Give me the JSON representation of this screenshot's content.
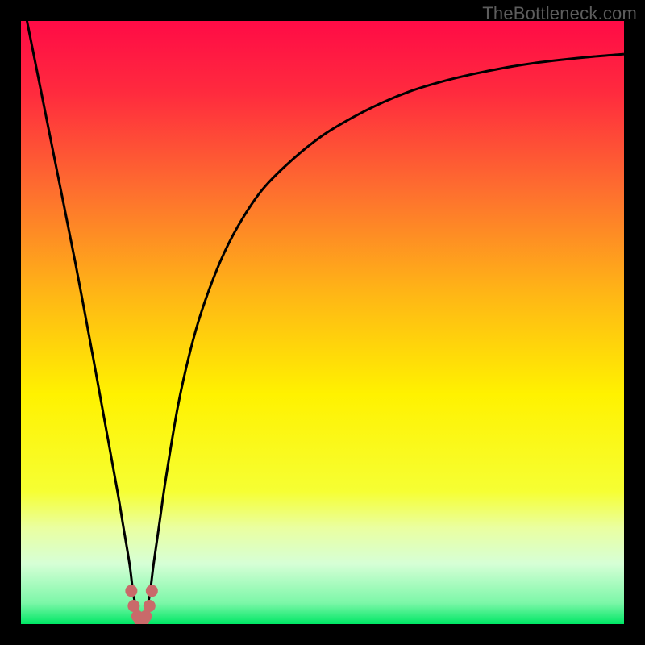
{
  "watermark": "TheBottleneck.com",
  "chart_data": {
    "type": "line",
    "title": "",
    "xlabel": "",
    "ylabel": "",
    "xlim": [
      0,
      100
    ],
    "ylim": [
      0,
      100
    ],
    "grid": false,
    "legend": false,
    "series": [
      {
        "name": "bottleneck-curve",
        "x": [
          0,
          3,
          6,
          9,
          12,
          14,
          16,
          17,
          18,
          18.5,
          19,
          19.5,
          20,
          20.5,
          21,
          21.5,
          22,
          23,
          24,
          26,
          28,
          30,
          33,
          36,
          40,
          45,
          50,
          55,
          60,
          65,
          70,
          75,
          80,
          85,
          90,
          95,
          100
        ],
        "y": [
          105,
          90,
          75,
          60,
          44,
          33,
          22,
          16,
          10,
          6,
          3,
          1,
          0.5,
          1,
          3,
          6,
          10,
          17,
          24,
          36,
          45,
          52,
          60,
          66,
          72,
          77,
          81,
          84,
          86.5,
          88.5,
          90,
          91.2,
          92.2,
          93,
          93.6,
          94.1,
          94.5
        ]
      },
      {
        "name": "marker-dots",
        "x": [
          18.3,
          18.7,
          19.3,
          19.7,
          20.3,
          20.7,
          21.3,
          21.7
        ],
        "y": [
          5.5,
          3.0,
          1.3,
          0.6,
          0.6,
          1.3,
          3.0,
          5.5
        ]
      }
    ],
    "background_gradient": {
      "stops": [
        {
          "pos": 0.0,
          "color": "#ff0b46"
        },
        {
          "pos": 0.12,
          "color": "#ff2b3e"
        },
        {
          "pos": 0.28,
          "color": "#fe6e2f"
        },
        {
          "pos": 0.45,
          "color": "#ffb516"
        },
        {
          "pos": 0.62,
          "color": "#fff200"
        },
        {
          "pos": 0.78,
          "color": "#f6ff33"
        },
        {
          "pos": 0.84,
          "color": "#eaffa0"
        },
        {
          "pos": 0.9,
          "color": "#d6ffd6"
        },
        {
          "pos": 0.965,
          "color": "#7cf7a8"
        },
        {
          "pos": 1.0,
          "color": "#00e765"
        }
      ]
    },
    "curve_color": "#000000",
    "marker_color": "#c96a6a"
  }
}
